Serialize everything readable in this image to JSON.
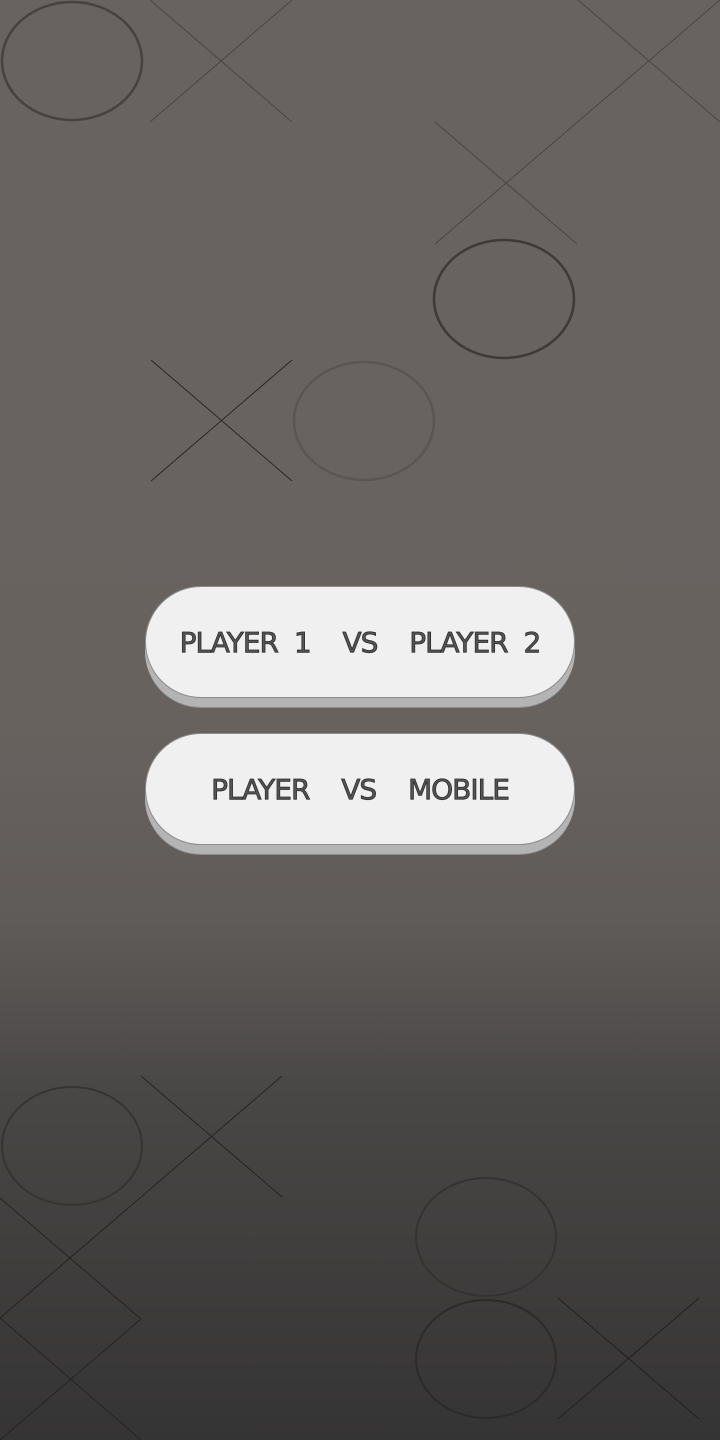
{
  "screen": {
    "background_top": "#686361",
    "background_bottom": "#353434"
  },
  "menu": {
    "pvp_label": "PLAYER 1  VS  PLAYER 2",
    "pvc_label": "PLAYER  VS  MOBILE"
  },
  "decor_icons": [
    "o-mark-icon",
    "x-mark-icon"
  ]
}
